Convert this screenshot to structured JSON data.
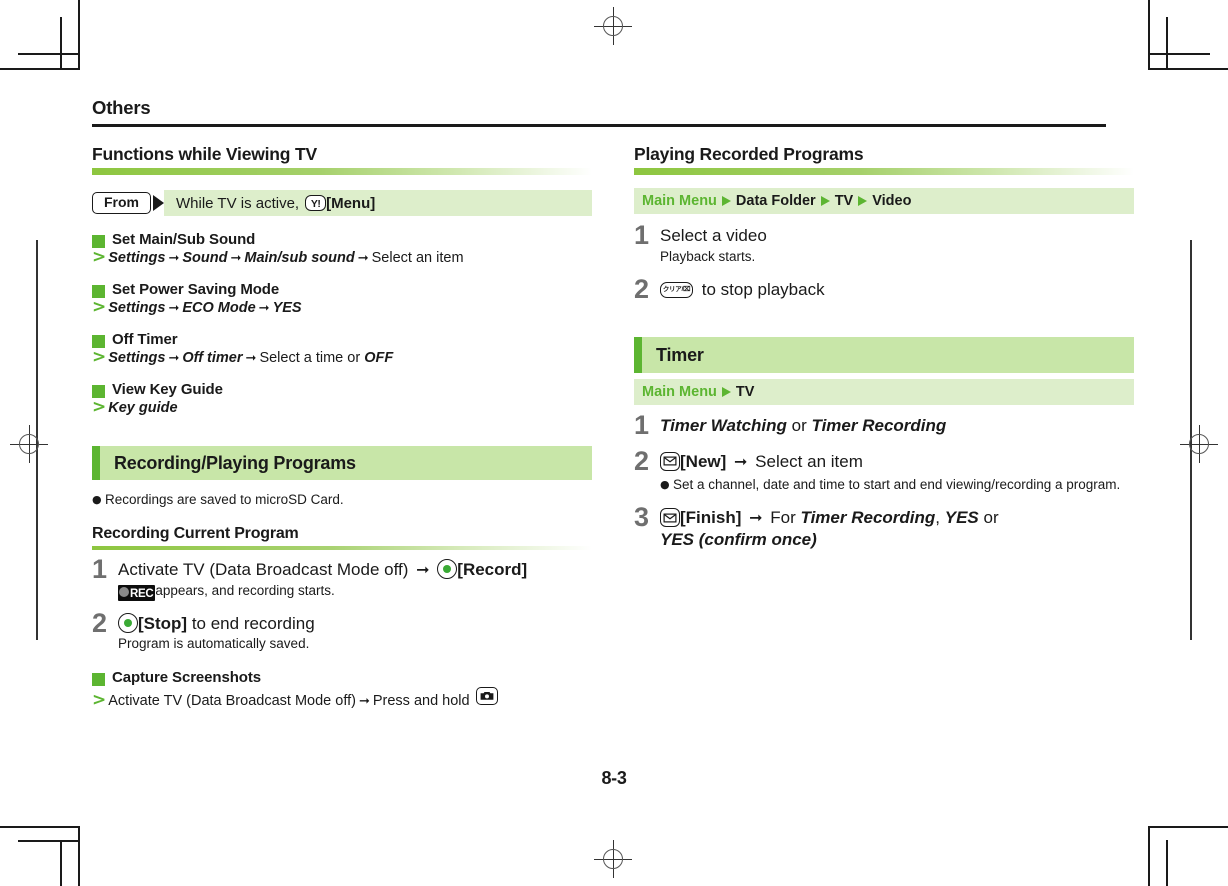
{
  "page": {
    "running_head": "Others",
    "page_number": "8-3"
  },
  "colors": {
    "accent_green": "#5cb531",
    "band_green": "#c8e6a8",
    "strip_green": "#ddeecb",
    "rule_black": "#1a1a1a"
  },
  "left_column": {
    "section_title": "Functions while Viewing TV",
    "from_strip": {
      "badge": "From",
      "text_before": "While TV is active,",
      "key_icon": "y-exclamation-key-icon",
      "key_label": "[Menu]"
    },
    "items": [
      {
        "heading": "Set Main/Sub Sound",
        "path": [
          "Settings",
          "Sound",
          "Main/sub sound"
        ],
        "tail": "Select an item"
      },
      {
        "heading": "Set Power Saving Mode",
        "path": [
          "Settings",
          "ECO Mode",
          "YES"
        ],
        "tail": ""
      },
      {
        "heading": "Off Timer",
        "path": [
          "Settings",
          "Off timer"
        ],
        "tail": "Select a time or",
        "tail_italic": "OFF"
      },
      {
        "heading": "View Key Guide",
        "path": [
          "Key guide"
        ],
        "tail": ""
      }
    ],
    "band_title": "Recording/Playing Programs",
    "band_note": "Recordings are saved to microSD Card.",
    "sub_title": "Recording Current Program",
    "steps": [
      {
        "number": "1",
        "main_before": "Activate TV (Data Broadcast Mode off)",
        "arrow": "→",
        "key_icon": "center-select-key-icon",
        "main_after": "[Record]",
        "note_badge": "REC",
        "note": "appears, and recording starts."
      },
      {
        "number": "2",
        "key_icon": "center-select-key-icon",
        "main_bold": "[Stop]",
        "main_after": "to end recording",
        "note": "Program is automatically saved."
      }
    ],
    "capture": {
      "heading": "Capture Screenshots",
      "text_before": "Activate TV (Data Broadcast Mode off)",
      "arrow": "→",
      "text_after": "Press and hold",
      "key_icon": "camera-key-icon"
    }
  },
  "right_column": {
    "section_title": "Playing Recorded Programs",
    "path_strip": [
      "Main Menu",
      "Data Folder",
      "TV",
      "Video"
    ],
    "steps": [
      {
        "number": "1",
        "main": "Select a video",
        "note": "Playback starts."
      },
      {
        "number": "2",
        "key_icon": "clear-key-icon",
        "key_text": "クリア/⌧",
        "main_after": "to stop playback"
      }
    ],
    "band_title": "Timer",
    "timer_path_strip": [
      "Main Menu",
      "TV"
    ],
    "timer_steps": [
      {
        "number": "1",
        "italic_a": "Timer Watching",
        "conj": "or",
        "italic_b": "Timer Recording"
      },
      {
        "number": "2",
        "key_icon": "mail-key-icon",
        "main_bold": "[New]",
        "arrow": "→",
        "main_after": "Select an item",
        "bullet": "Set a channel, date and time to start and end viewing/recording a program."
      },
      {
        "number": "3",
        "key_icon": "mail-key-icon",
        "main_bold": "[Finish]",
        "arrow": "→",
        "text_for": "For",
        "italic_a": "Timer Recording",
        "comma": ",",
        "italic_b": "YES",
        "conj": "or",
        "italic_c": "YES (confirm once)"
      }
    ]
  }
}
